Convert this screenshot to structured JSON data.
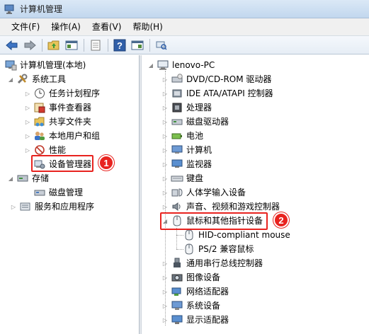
{
  "window": {
    "title": "计算机管理"
  },
  "menu": [
    "文件(F)",
    "操作(A)",
    "查看(V)",
    "帮助(H)"
  ],
  "left_tree": {
    "root": "计算机管理(本地)",
    "system_tools": "系统工具",
    "task_scheduler": "任务计划程序",
    "event_viewer": "事件查看器",
    "shared_folders": "共享文件夹",
    "local_users": "本地用户和组",
    "performance": "性能",
    "device_manager": "设备管理器",
    "storage": "存储",
    "disk_management": "磁盘管理",
    "services_apps": "服务和应用程序"
  },
  "right_tree": {
    "root": "lenovo-PC",
    "items": [
      "DVD/CD-ROM 驱动器",
      "IDE ATA/ATAPI 控制器",
      "处理器",
      "磁盘驱动器",
      "电池",
      "计算机",
      "监视器",
      "键盘",
      "人体学输入设备",
      "声音、视频和游戏控制器",
      "鼠标和其他指针设备",
      "HID-compliant mouse",
      "PS/2 兼容鼠标",
      "通用串行总线控制器",
      "图像设备",
      "网络适配器",
      "系统设备",
      "显示适配器"
    ]
  },
  "annotations": {
    "badge1": "1",
    "badge2": "2"
  },
  "colors": {
    "highlight": "#e8231f",
    "title_bar": "#c2d7ee"
  }
}
